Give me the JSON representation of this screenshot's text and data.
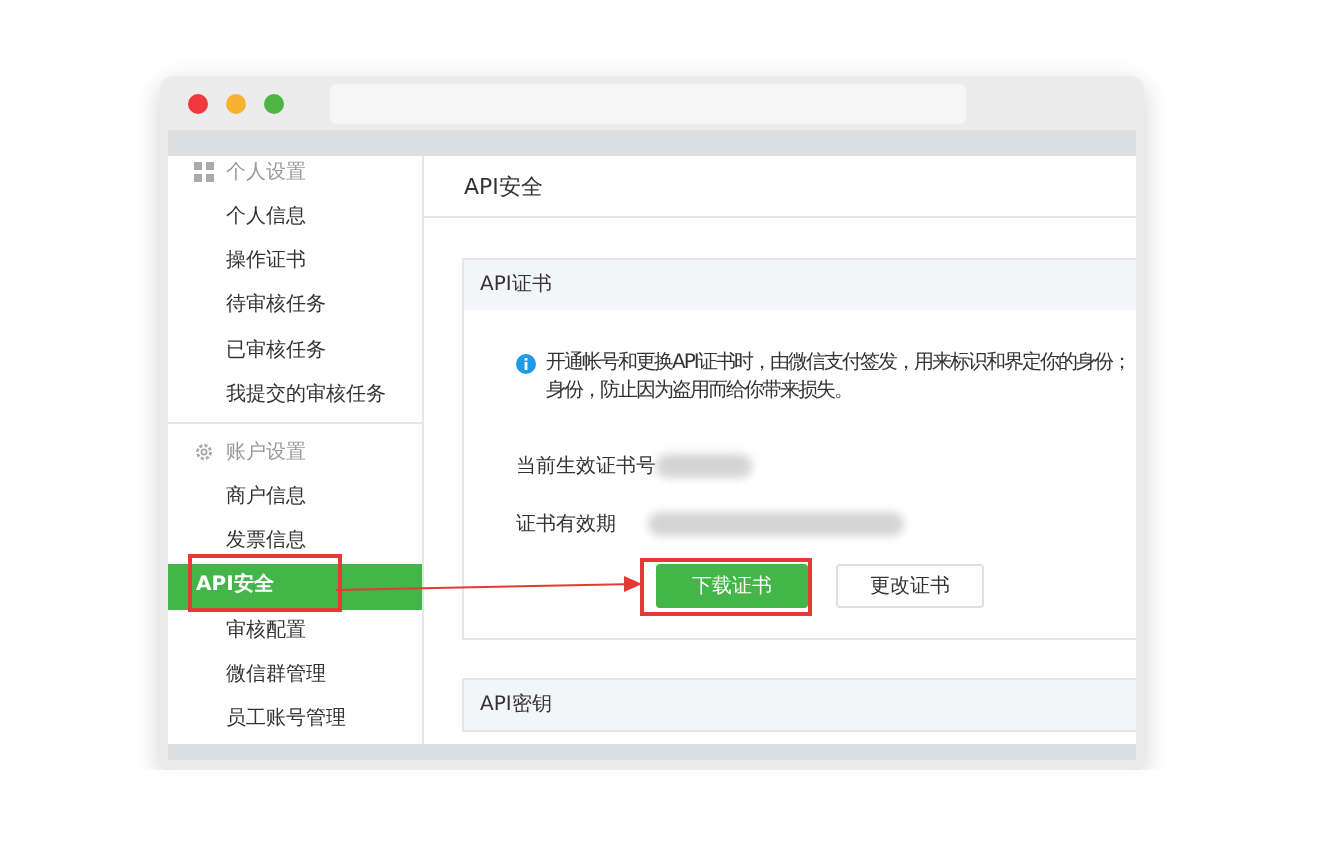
{
  "sidebar": {
    "groups": [
      {
        "title": "个人设置",
        "kind": "grid",
        "items": [
          {
            "label": "个人信息",
            "selected": false
          },
          {
            "label": "操作证书",
            "selected": false
          },
          {
            "label": "待审核任务",
            "selected": false
          },
          {
            "label": "已审核任务",
            "selected": false
          },
          {
            "label": "我提交的审核任务",
            "selected": false
          }
        ]
      },
      {
        "title": "账户设置",
        "kind": "gear",
        "items": [
          {
            "label": "商户信息",
            "selected": false
          },
          {
            "label": "发票信息",
            "selected": false
          },
          {
            "label": "API安全",
            "selected": true
          },
          {
            "label": "审核配置",
            "selected": false
          },
          {
            "label": "微信群管理",
            "selected": false
          },
          {
            "label": "员工账号管理",
            "selected": false
          }
        ]
      }
    ]
  },
  "page": {
    "title": "API安全"
  },
  "cards": [
    {
      "title": "API证书",
      "info": [
        "开通帐号和更换API证书时，由微信支付签发，用来标识和界定你的身份；",
        "身份，防止因为盗用而给你带来损失。"
      ],
      "fields": [
        {
          "label": "当前生效证书号"
        },
        {
          "label": "证书有效期"
        }
      ],
      "buttons": [
        {
          "label": "下载证书",
          "kind": "primary"
        },
        {
          "label": "更改证书",
          "kind": "default"
        }
      ]
    },
    {
      "title": "API密钥"
    }
  ]
}
